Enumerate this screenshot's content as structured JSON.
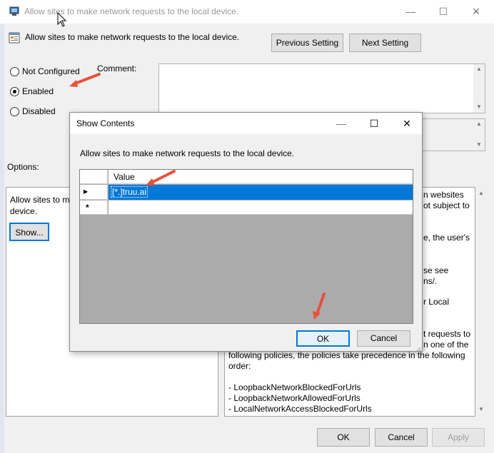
{
  "window": {
    "title": "Allow sites to make network requests to the local device.",
    "minimize_icon": "minimize-icon",
    "maximize_icon": "maximize-icon",
    "close_icon": "close-icon"
  },
  "header": {
    "setting_title": "Allow sites to make network requests to the local device.",
    "previous_label": "Previous Setting",
    "next_label": "Next Setting"
  },
  "state": {
    "options": [
      {
        "label": "Not Configured",
        "checked": false
      },
      {
        "label": "Enabled",
        "checked": true
      },
      {
        "label": "Disabled",
        "checked": false
      }
    ]
  },
  "comment_label": "Comment:",
  "options_label": "Options:",
  "options_panel": {
    "text_line1": "Allow sites to ma",
    "text_line2": "device.",
    "show_label": "Show..."
  },
  "help_panel": {
    "lines": [
      "n websites",
      "ot subject to",
      "e, the user's",
      "se see",
      "ns/.",
      "r Local",
      "t requests to",
      "n one of the",
      "following policies, the policies take precedence in the following",
      "order:",
      "- LoopbackNetworkBlockedForUrls",
      "- LoopbackNetworkAllowedForUrls",
      "- LocalNetworkAccessBlockedForUrls"
    ]
  },
  "footer": {
    "ok_label": "OK",
    "cancel_label": "Cancel",
    "apply_label": "Apply"
  },
  "dialog": {
    "title": "Show Contents",
    "description": "Allow sites to make network requests to the local device.",
    "column_header": "Value",
    "rows": [
      {
        "marker": "▶",
        "value": "[*.]truu.ai",
        "selected": true
      },
      {
        "marker": "*",
        "value": "",
        "selected": false
      }
    ],
    "ok_label": "OK",
    "cancel_label": "Cancel"
  },
  "colors": {
    "selection": "#0078d7",
    "annotation_arrow": "#e8503a",
    "focus_border": "#0078d7"
  }
}
